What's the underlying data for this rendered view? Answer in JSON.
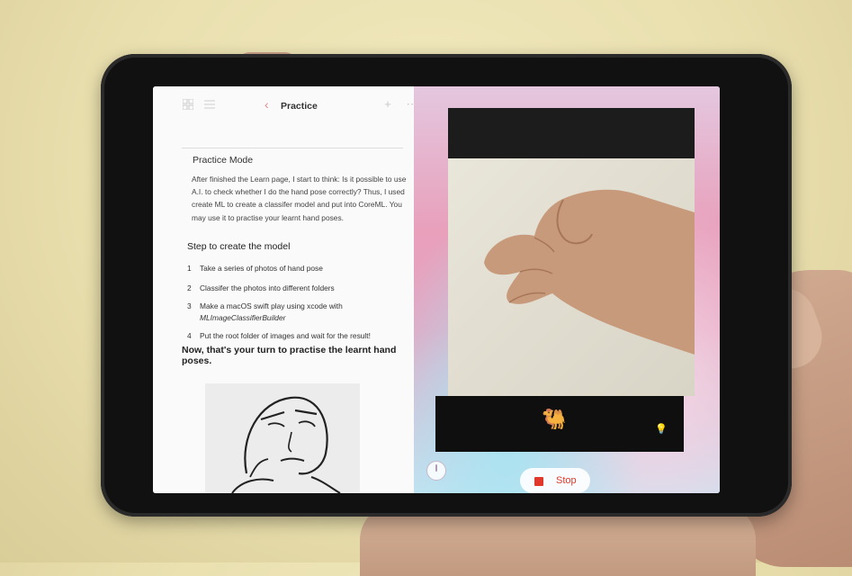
{
  "navbar": {
    "title": "Practice",
    "back_icon": "chevron-left-icon",
    "icons": [
      "grid-icon",
      "list-icon",
      "plus-icon",
      "more-icon"
    ]
  },
  "content": {
    "heading": "Practice Mode",
    "intro": "After finished the Learn page, I start to think: Is it possible to use A.I. to check whether I do the hand pose correctly? Thus, I used create ML to create a classifer model and put into CoreML. You may use it to practise your learnt hand poses.",
    "steps_heading": "Step to create the model",
    "steps": [
      {
        "num": "1",
        "text": "Take a series of photos of hand pose"
      },
      {
        "num": "2",
        "text": "Classifer the photos into different folders"
      },
      {
        "num": "3",
        "text": "Make a macOS swift play using xcode with",
        "code": "MLImageClassifierBuilder"
      },
      {
        "num": "4",
        "text": "Put the root folder of images and wait for the result!"
      }
    ],
    "turn_text": "Now, that's your turn to practise the learnt hand poses."
  },
  "camera": {
    "result_emoji": "🐫",
    "result_icon": "camel-icon",
    "bulb_icon": "lightbulb-icon"
  },
  "controls": {
    "stop_label": "Stop",
    "stop_color": "#e0392b",
    "speed_icon": "speedometer-icon"
  }
}
